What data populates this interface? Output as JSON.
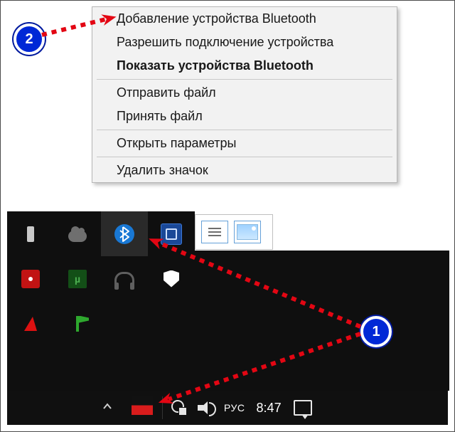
{
  "menu": {
    "group1": [
      "Добавление устройства Bluetooth",
      "Разрешить подключение устройства",
      "Показать устройства Bluetooth"
    ],
    "group2": [
      "Отправить файл",
      "Принять файл"
    ],
    "group3": [
      "Открыть параметры"
    ],
    "group4": [
      "Удалить значок"
    ],
    "bold_index": 2
  },
  "taskbar": {
    "language": "РУС",
    "time": "8:47"
  },
  "badges": {
    "step1": "1",
    "step2": "2"
  },
  "tray_icons": {
    "usb": "usb-icon",
    "onedrive": "onedrive-icon",
    "bluetooth": "bluetooth-icon",
    "intel": "intel-graphics-icon",
    "camera": "camera-icon",
    "utorrent": "utorrent-icon",
    "audio": "headphones-icon",
    "defender": "windows-defender-icon",
    "avast": "avast-icon",
    "flag": "flag-icon",
    "utorrent_label": "µ"
  }
}
